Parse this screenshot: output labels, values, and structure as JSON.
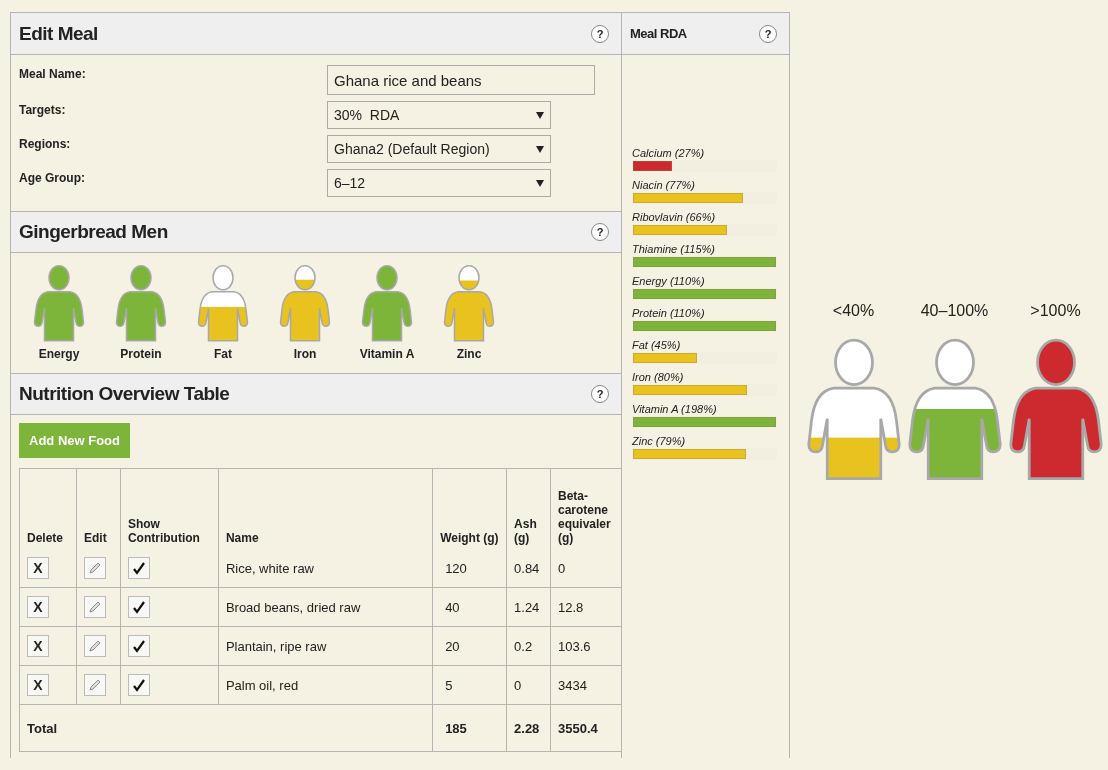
{
  "edit_meal": {
    "title": "Edit Meal",
    "help": "?",
    "fields": [
      {
        "label": "Meal Name:",
        "kind": "text",
        "value": "Ghana rice and beans"
      },
      {
        "label": "Targets:",
        "kind": "select",
        "value": "30%  RDA"
      },
      {
        "label": "Regions:",
        "kind": "select",
        "value": "Ghana2 (Default Region)"
      },
      {
        "label": "Age Group:",
        "kind": "select",
        "value": "6–12"
      }
    ]
  },
  "gingerbread": {
    "title": "Gingerbread Men",
    "help": "?",
    "figures": [
      {
        "label": "Energy",
        "level": 1,
        "color": "#7db43a"
      },
      {
        "label": "Protein",
        "level": 1,
        "color": "#7db43a"
      },
      {
        "label": "Fat",
        "level": 0.45,
        "color": "#e8c21f"
      },
      {
        "label": "Iron",
        "level": 0.8,
        "color": "#e8c21f"
      },
      {
        "label": "Vitamin A",
        "level": 1,
        "color": "#7db43a"
      },
      {
        "label": "Zinc",
        "level": 0.79,
        "color": "#e8c21f"
      }
    ]
  },
  "nutrition": {
    "title": "Nutrition Overview Table",
    "help": "?",
    "add_button": "Add New Food",
    "columns": [
      "Delete",
      "Edit",
      "Show Contribution",
      "Name",
      "Weight (g)",
      "Ash (g)",
      "Beta-carotene equivaler (g)"
    ],
    "rows": [
      {
        "delete": "X",
        "show_contribution": true,
        "name": "Rice, white raw",
        "weight": "120",
        "ash": "0.84",
        "beta_carotene": "0"
      },
      {
        "delete": "X",
        "show_contribution": true,
        "name": "Broad beans, dried raw",
        "weight": "40",
        "ash": "1.24",
        "beta_carotene": "12.8"
      },
      {
        "delete": "X",
        "show_contribution": true,
        "name": "Plantain, ripe raw",
        "weight": "20",
        "ash": "0.2",
        "beta_carotene": "103.6"
      },
      {
        "delete": "X",
        "show_contribution": true,
        "name": "Palm oil, red",
        "weight": "5",
        "ash": "0",
        "beta_carotene": "3434"
      }
    ],
    "total": {
      "label": "Total",
      "weight": "185",
      "ash": "2.28",
      "beta_carotene": "3550.4"
    }
  },
  "meal_rda": {
    "title": "Meal RDA",
    "help": "?",
    "nutrients": [
      {
        "label": "Calcium (27%)",
        "level": 0.27,
        "color": "#cc2a2e"
      },
      {
        "label": "Niacin (77%)",
        "level": 0.77,
        "color": "#e8c21f"
      },
      {
        "label": "Ribovlavin (66%)",
        "level": 0.66,
        "color": "#e8c21f"
      },
      {
        "label": "Thiamine (115%)",
        "level": 1,
        "color": "#7db43a"
      },
      {
        "label": "Energy (110%)",
        "level": 1,
        "color": "#7db43a"
      },
      {
        "label": "Protein (110%)",
        "level": 1,
        "color": "#7db43a"
      },
      {
        "label": "Fat (45%)",
        "level": 0.45,
        "color": "#e8c21f"
      },
      {
        "label": "Iron (80%)",
        "level": 0.8,
        "color": "#e8c21f"
      },
      {
        "label": "Vitamin A (198%)",
        "level": 1,
        "color": "#7db43a"
      },
      {
        "label": "Zinc (79%)",
        "level": 0.79,
        "color": "#e8c21f"
      }
    ]
  },
  "legend": [
    {
      "label": "<40%",
      "level": 0.3,
      "color": "#e8c21f"
    },
    {
      "label": "40–100%",
      "level": 0.5,
      "color": "#7db43a"
    },
    {
      "label": ">100%",
      "level": 1,
      "color": "#cc2a2e"
    }
  ]
}
